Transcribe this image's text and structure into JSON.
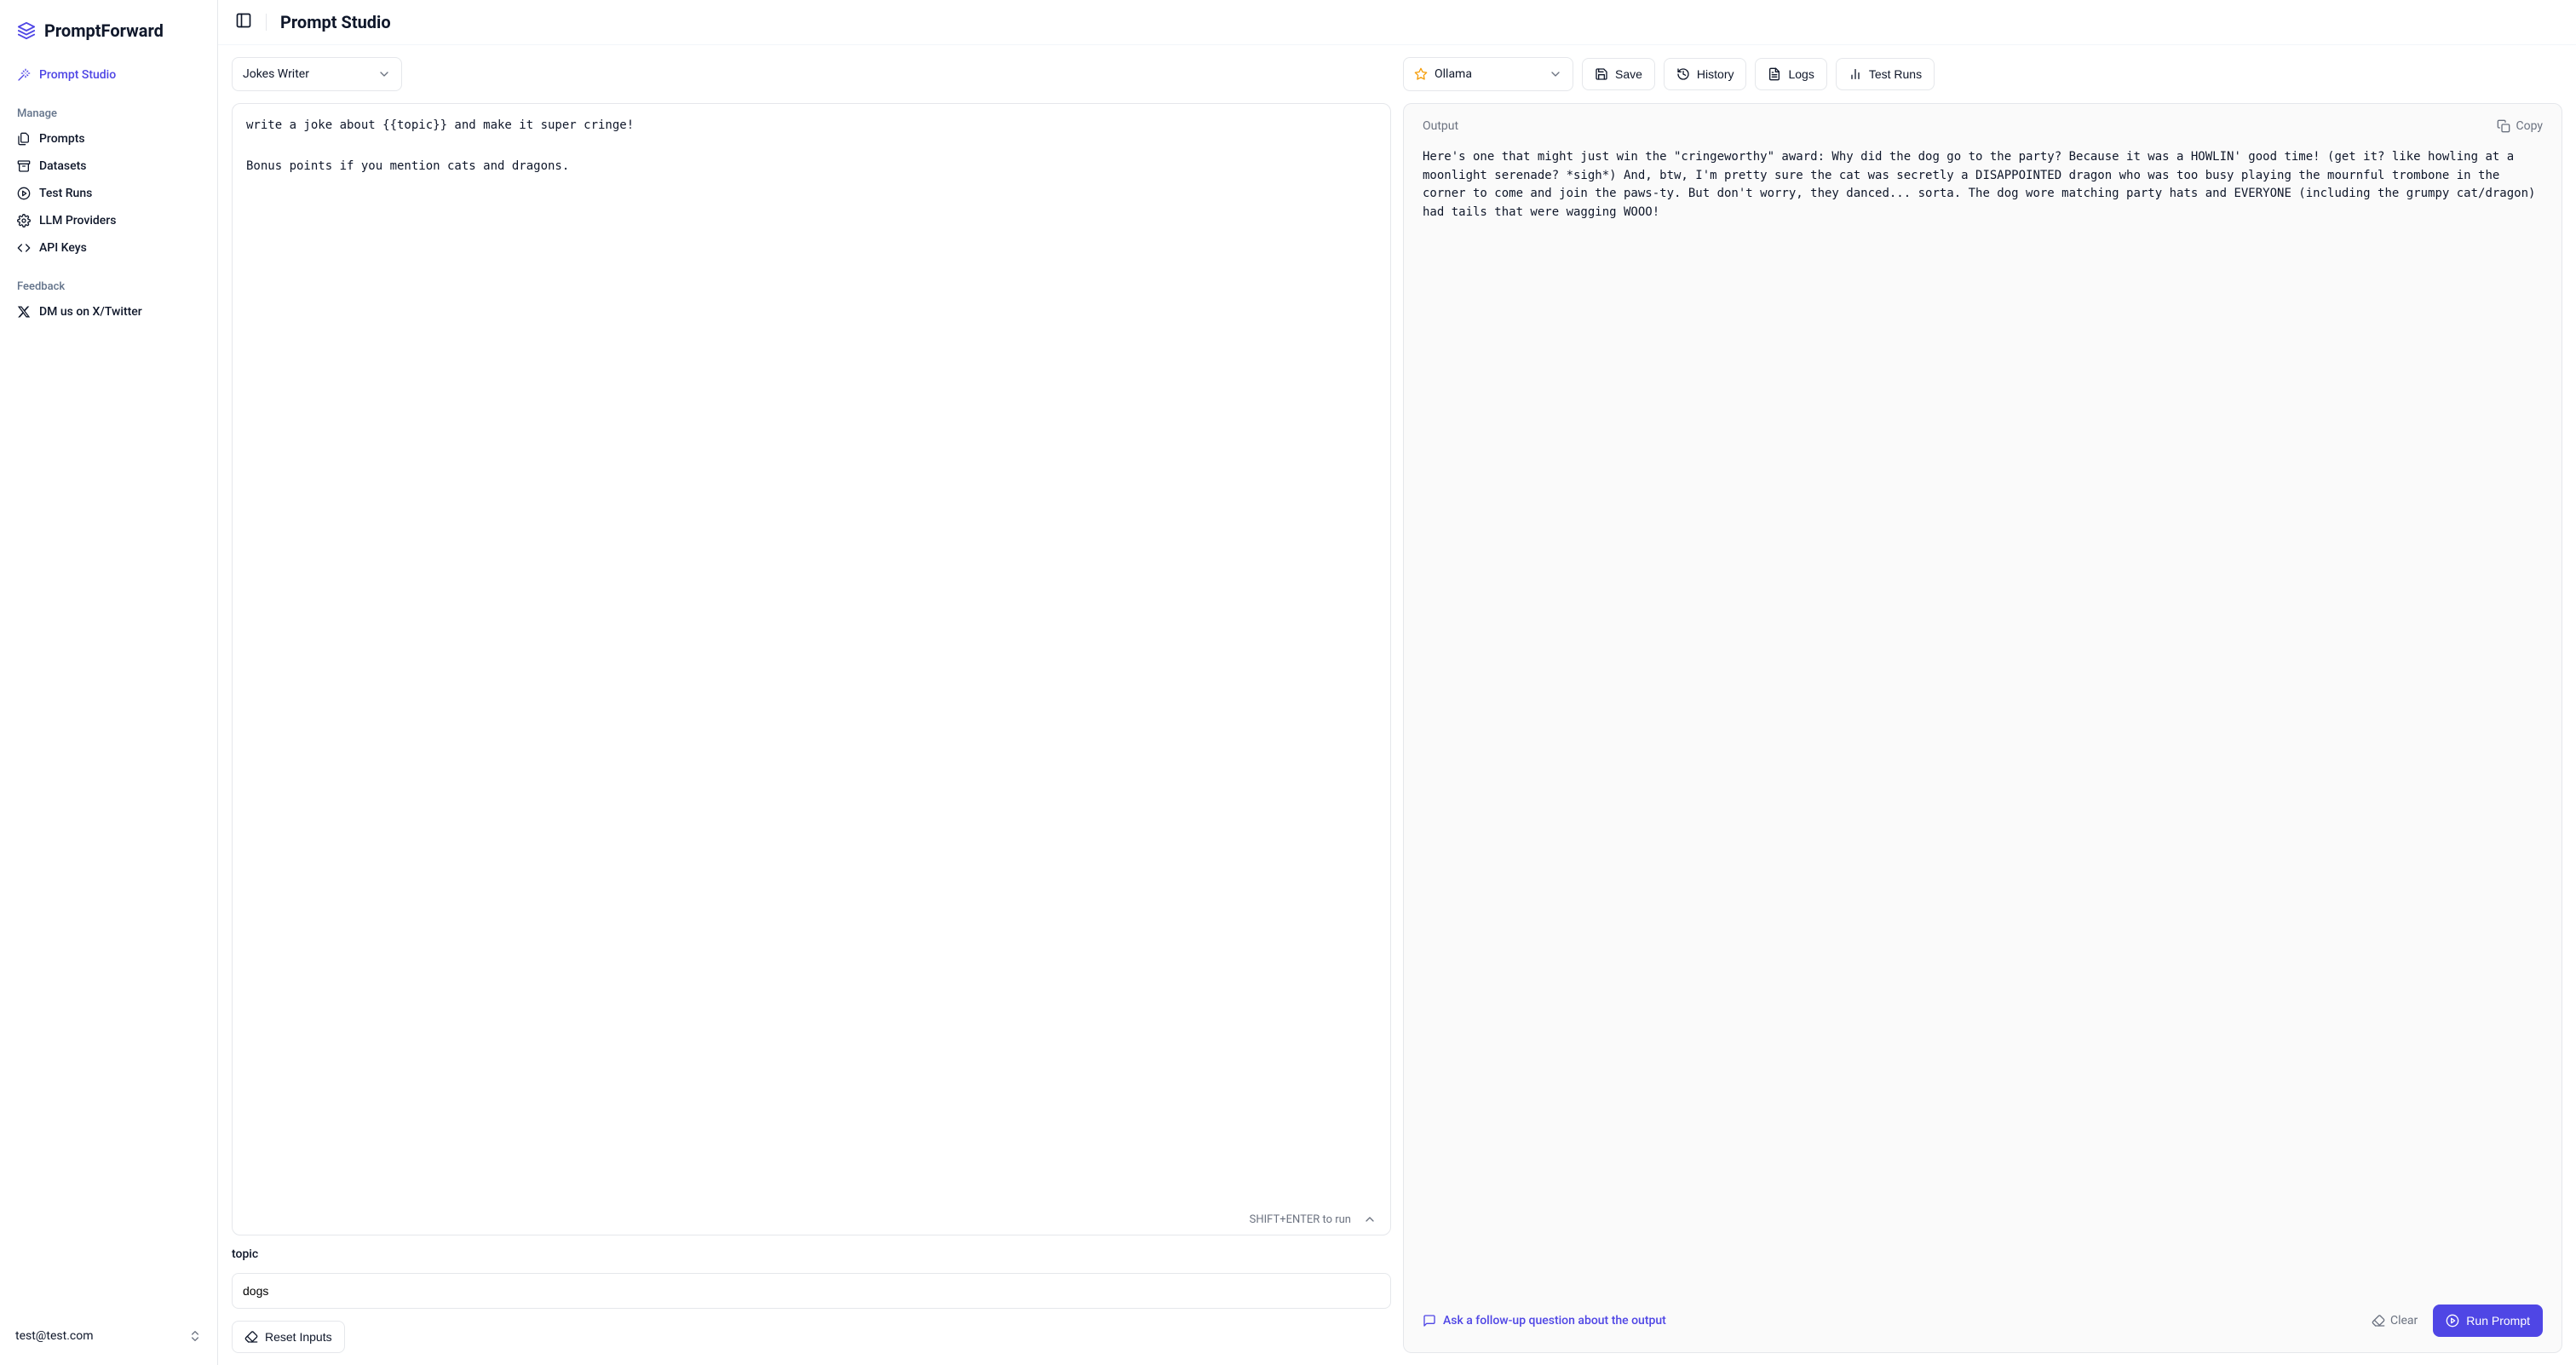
{
  "brand": "PromptForward",
  "page_title": "Prompt Studio",
  "sidebar": {
    "active": {
      "label": "Prompt Studio"
    },
    "sections": {
      "manage": {
        "heading": "Manage",
        "items": [
          {
            "label": "Prompts"
          },
          {
            "label": "Datasets"
          },
          {
            "label": "Test Runs"
          },
          {
            "label": "LLM Providers"
          },
          {
            "label": "API Keys"
          }
        ]
      },
      "feedback": {
        "heading": "Feedback",
        "items": [
          {
            "label": "DM us on X/Twitter"
          }
        ]
      }
    },
    "footer_email": "test@test.com"
  },
  "toolbar": {
    "prompt_select": "Jokes Writer",
    "provider_select": "Ollama",
    "save_label": "Save",
    "history_label": "History",
    "logs_label": "Logs",
    "test_runs_label": "Test Runs"
  },
  "editor": {
    "content": "write a joke about {{topic}} and make it super cringe!\n\nBonus points if you mention cats and dragons.",
    "hint": "SHIFT+ENTER to run"
  },
  "variables": {
    "topic_label": "topic",
    "topic_value": "dogs"
  },
  "buttons": {
    "reset_inputs": "Reset Inputs",
    "copy": "Copy",
    "clear": "Clear",
    "followup": "Ask a follow-up question about the output",
    "run_prompt": "Run Prompt"
  },
  "output": {
    "heading": "Output",
    "body": "Here's one that might just win the \"cringeworthy\" award: Why did the dog go to the party? Because it was a HOWLIN' good time! (get it? like howling at a moonlight serenade? *sigh*) And, btw, I'm pretty sure the cat was secretly a DISAPPOINTED dragon who was too busy playing the mournful trombone in the corner to come and join the paws-ty. But don't worry, they danced... sorta. The dog wore matching party hats and EVERYONE (including the grumpy cat/dragon) had tails that were wagging WOOO!"
  }
}
